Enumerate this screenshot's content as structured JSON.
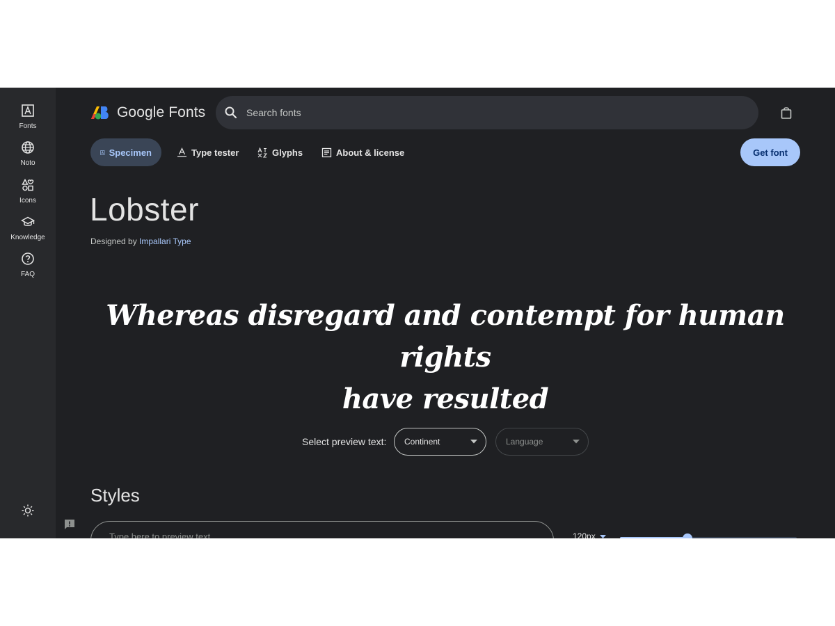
{
  "rail": {
    "items": [
      {
        "label": "Fonts",
        "icon": "font-icon"
      },
      {
        "label": "Noto",
        "icon": "globe-icon"
      },
      {
        "label": "Icons",
        "icon": "shapes-icon"
      },
      {
        "label": "Knowledge",
        "icon": "graduation-cap-icon"
      },
      {
        "label": "FAQ",
        "icon": "help-icon"
      }
    ],
    "theme_icon": "brightness-icon"
  },
  "header": {
    "logo_text": "Google Fonts",
    "search_placeholder": "Search fonts",
    "bag_icon": "shopping-bag-icon"
  },
  "tabs": [
    {
      "label": "Specimen",
      "active": true
    },
    {
      "label": "Type tester",
      "active": false
    },
    {
      "label": "Glyphs",
      "active": false
    },
    {
      "label": "About & license",
      "active": false
    }
  ],
  "get_font_label": "Get font",
  "font": {
    "name": "Lobster",
    "designed_by_prefix": "Designed by ",
    "designer": "Impallari Type"
  },
  "preview": {
    "line1": "Whereas disregard and contempt for human rights",
    "line2": "have resulted"
  },
  "preview_controls": {
    "label": "Select preview text:",
    "continent": "Continent",
    "language_placeholder": "Language"
  },
  "styles": {
    "heading": "Styles",
    "input_placeholder": "Type here to preview text",
    "size": "120px",
    "size_slider_fraction": 0.38
  },
  "colors": {
    "background": "#1f2023",
    "rail": "#28292c",
    "accent": "#a8c7fa",
    "text": "#e3e3e3"
  }
}
